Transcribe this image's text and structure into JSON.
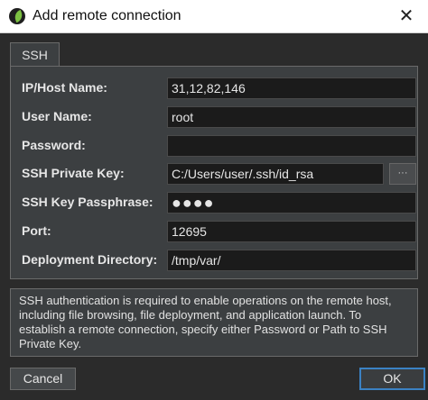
{
  "window": {
    "title": "Add remote connection",
    "close_glyph": "✕",
    "icon": "app-leaf-icon"
  },
  "tabs": [
    {
      "label": "SSH",
      "active": true
    }
  ],
  "form": {
    "ip_host": {
      "label": "IP/Host Name:",
      "value": "31,12,82,146"
    },
    "user_name": {
      "label": "User Name:",
      "value": "root"
    },
    "password": {
      "label": "Password:",
      "value": ""
    },
    "private_key": {
      "label": "SSH Private Key:",
      "value": "C:/Users/user/.ssh/id_rsa",
      "browse_label": "···"
    },
    "passphrase": {
      "label": "SSH Key Passphrase:",
      "value": "●●●●"
    },
    "port": {
      "label": "Port:",
      "value": "12695"
    },
    "deploy_dir": {
      "label": "Deployment Directory:",
      "value": "/tmp/var/"
    }
  },
  "info_text": "SSH authentication is required to enable operations on the remote host, including file browsing, file deployment, and application launch. To establish a remote connection, specify either Password or Path to SSH Private Key.",
  "buttons": {
    "cancel": "Cancel",
    "ok": "OK"
  },
  "colors": {
    "background": "#2b2b2b",
    "panel": "#3c3f41",
    "field": "#1b1b1b",
    "accent_focus": "#3b82c4",
    "brand_green": "#7cc142"
  }
}
